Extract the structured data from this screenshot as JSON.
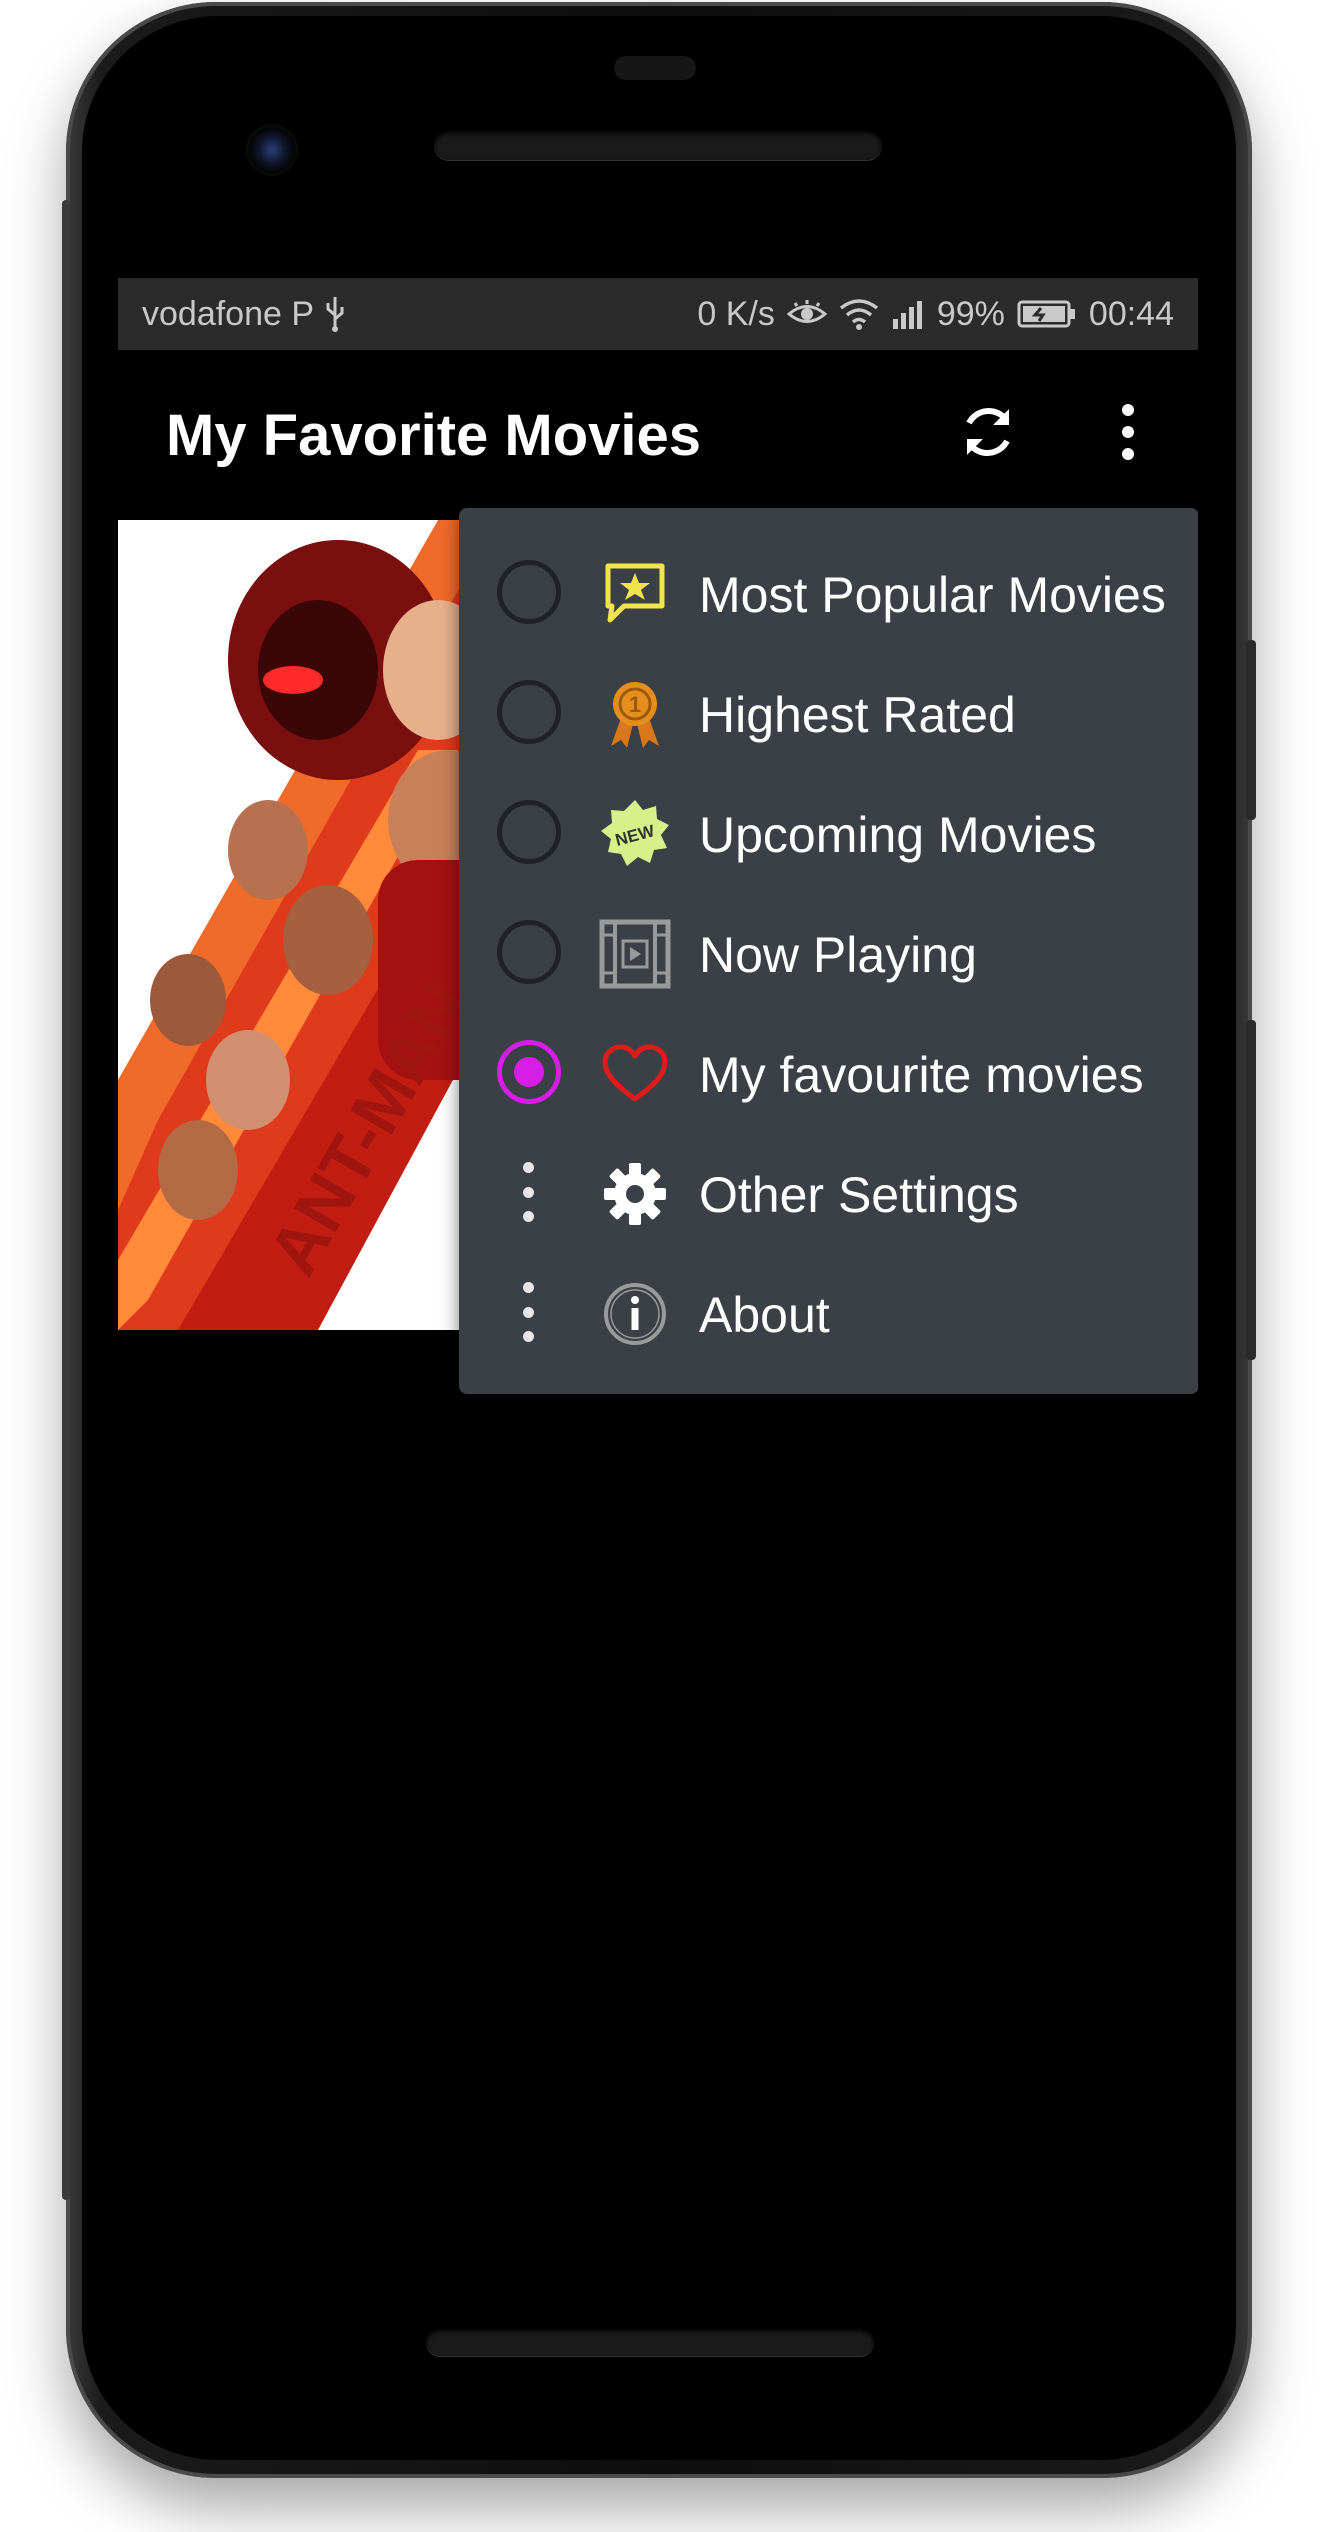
{
  "status_bar": {
    "carrier": "vodafone P",
    "network_speed": "0 K/s",
    "battery_percent": "99%",
    "time": "00:44",
    "icons": [
      "usb-icon",
      "eye-comfort-icon",
      "wifi-icon",
      "signal-icon",
      "battery-charging-icon"
    ]
  },
  "app_bar": {
    "title": "My Favorite Movies",
    "actions": [
      "refresh-icon",
      "overflow-menu-icon"
    ]
  },
  "poster": {
    "icon": "movie-poster-image"
  },
  "menu": {
    "items": [
      {
        "label": "Most Popular Movies",
        "control": "radio",
        "checked": false,
        "icon": "star-speech-bubble-icon",
        "icon_color": "#f0e44a"
      },
      {
        "label": "Highest Rated",
        "control": "radio",
        "checked": false,
        "icon": "award-ribbon-icon",
        "icon_color": "#e58e1d"
      },
      {
        "label": "Upcoming Movies",
        "control": "radio",
        "checked": false,
        "icon": "new-badge-icon",
        "icon_color": "#d8f08a"
      },
      {
        "label": "Now Playing",
        "control": "radio",
        "checked": false,
        "icon": "film-play-icon",
        "icon_color": "#9a9a9a"
      },
      {
        "label": "My favourite movies",
        "control": "radio",
        "checked": true,
        "icon": "heart-icon",
        "icon_color": "#e01b1b"
      },
      {
        "label": "Other Settings",
        "control": "more",
        "icon": "gear-icon",
        "icon_color": "#ffffff"
      },
      {
        "label": "About",
        "control": "more",
        "icon": "info-icon",
        "icon_color": "#9a9a9a"
      }
    ],
    "new_badge_text": "NEW",
    "award_number": "1"
  },
  "colors": {
    "menu_background": "#3b4046",
    "radio_checked": "#d61ee8",
    "status_bar_background": "#2b2b2b"
  }
}
